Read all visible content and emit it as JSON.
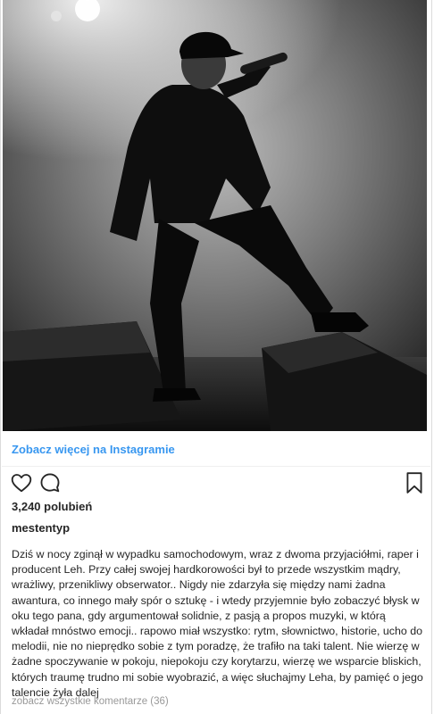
{
  "post": {
    "see_more_link": "Zobacz więcej na Instagramie",
    "likes_text": "3,240 polubień",
    "username": "mestentyp",
    "caption": "Dziś w nocy zginął w wypadku samochodowym, wraz z dwoma przyjaciółmi, raper i producent Leh. Przy całej swojej hardkorowości był to przede wszystkim mądry, wrażliwy, przenikliwy obserwator.. Nigdy nie zdarzyła się między nami żadna awantura, co innego mały spór o sztukę - i wtedy przyjemnie było zobaczyć błysk w oku tego pana, gdy argumentował solidnie, z pasją a propos muzyki, w którą wkładał mnóstwo emocji.. rapowo miał wszystko: rytm, słownictwo, historie, ucho do melodii, nie no nieprędko sobie z tym poradzę, że trafiło na taki talent. Nie wierzę w żadne spoczywanie w pokoju, niepokoju czy korytarzu, wierzę we wsparcie bliskich, których traumę trudno mi sobie wyobrazić, a więc słuchajmy Leha, by pamięć o jego talencie żyła dalej",
    "view_comments": "zobacz wszystkie komentarze (36)"
  },
  "icons": {
    "like": "heart-icon",
    "comment": "comment-bubble-icon",
    "save": "bookmark-icon"
  }
}
